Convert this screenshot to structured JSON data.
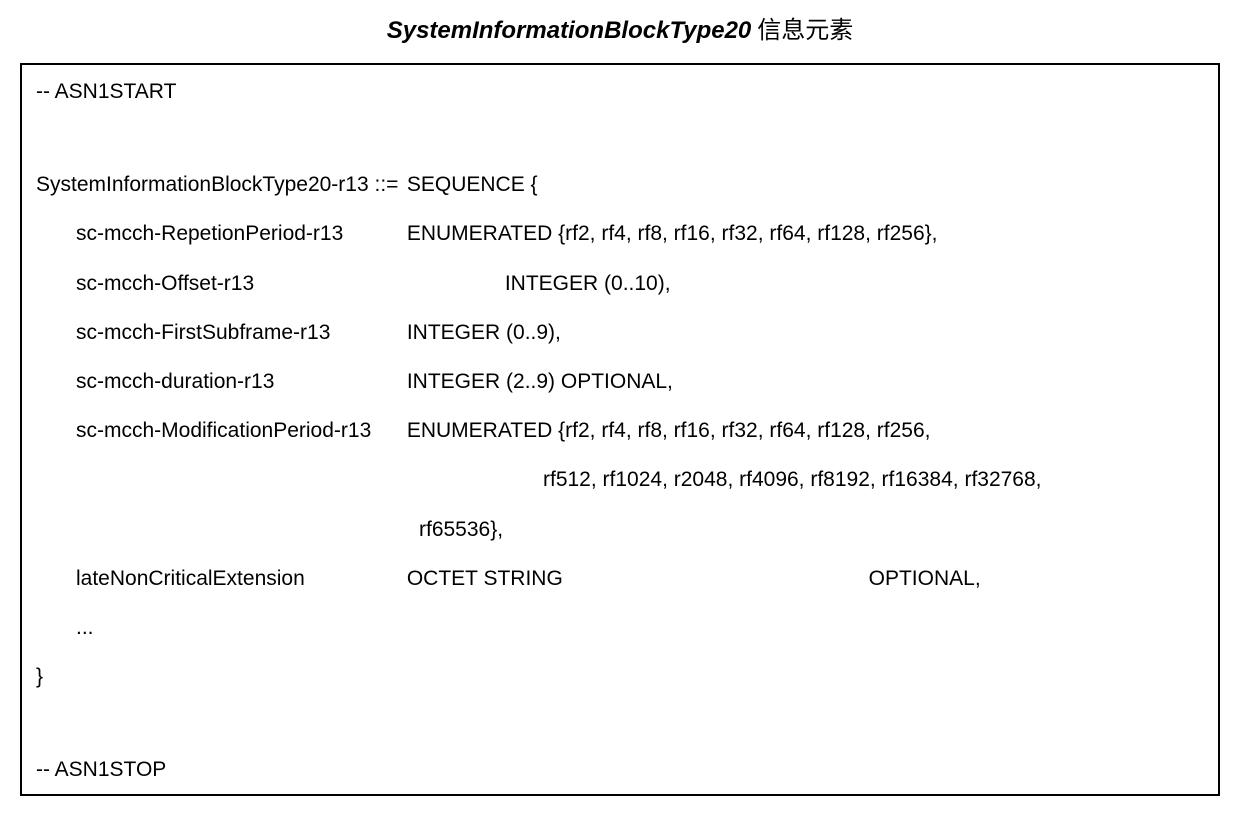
{
  "title_italic": "SystemInformationBlockType20",
  "title_cjk": "信息元素",
  "asn1start": "-- ASN1START",
  "asn1stop": "-- ASN1STOP",
  "type_name": "SystemInformationBlockType20-r13 ::=",
  "seq_open": "SEQUENCE {",
  "fields": {
    "f0_name": "sc-mcch-RepetionPeriod-r13",
    "f0_def": "ENUMERATED {rf2, rf4, rf8, rf16, rf32, rf64, rf128, rf256},",
    "f1_name": "sc-mcch-Offset-r13",
    "f1_def": "INTEGER (0..10),",
    "f2_name": "sc-mcch-FirstSubframe-r13",
    "f2_def": "INTEGER (0..9),",
    "f3_name": "sc-mcch-duration-r13",
    "f3_def": "INTEGER (2..9) OPTIONAL,",
    "f4_name": "sc-mcch-ModificationPeriod-r13",
    "f4_def": "ENUMERATED {rf2, rf4, rf8, rf16, rf32, rf64, rf128, rf256,",
    "f4_cont1": "rf512, rf1024, r2048, rf4096, rf8192, rf16384, rf32768,",
    "f4_cont2": "rf65536},",
    "f5_name": "lateNonCriticalExtension",
    "f5_def_a": "OCTET STRING",
    "f5_def_b": "OPTIONAL,",
    "ellipsis": "..."
  },
  "close_brace": "}"
}
